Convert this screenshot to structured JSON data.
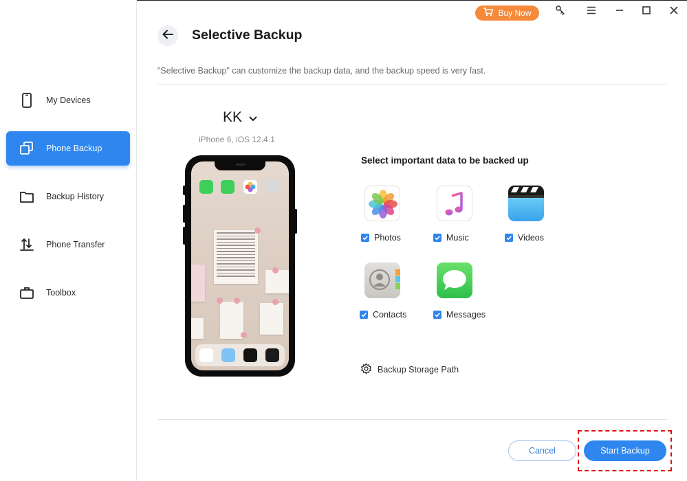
{
  "sidebar": {
    "items": [
      {
        "label": "My Devices",
        "icon": "phone-icon"
      },
      {
        "label": "Phone Backup",
        "icon": "copy-icon",
        "active": true
      },
      {
        "label": "Backup History",
        "icon": "folder-icon"
      },
      {
        "label": "Phone Transfer",
        "icon": "transfer-icon"
      },
      {
        "label": "Toolbox",
        "icon": "briefcase-icon"
      }
    ]
  },
  "titlebar": {
    "buy_label": "Buy Now",
    "buy_color": "#f58a3b"
  },
  "header": {
    "title": "Selective Backup",
    "description": "\"Selective Backup\" can customize the backup data, and the backup speed is very fast."
  },
  "device": {
    "name": "KK",
    "model": "iPhone 6, iOS 12.4.1"
  },
  "data_section": {
    "title": "Select important data to be backed up",
    "items": [
      {
        "label": "Photos",
        "checked": true,
        "icon": "photos-icon"
      },
      {
        "label": "Music",
        "checked": true,
        "icon": "music-icon"
      },
      {
        "label": "Videos",
        "checked": true,
        "icon": "videos-icon"
      },
      {
        "label": "Contacts",
        "checked": true,
        "icon": "contacts-icon"
      },
      {
        "label": "Messages",
        "checked": true,
        "icon": "messages-icon"
      }
    ],
    "storage_label": "Backup Storage Path"
  },
  "footer": {
    "cancel_label": "Cancel",
    "start_label": "Start Backup"
  },
  "colors": {
    "accent": "#2f86ef",
    "highlight_border": "#e00f0f"
  }
}
